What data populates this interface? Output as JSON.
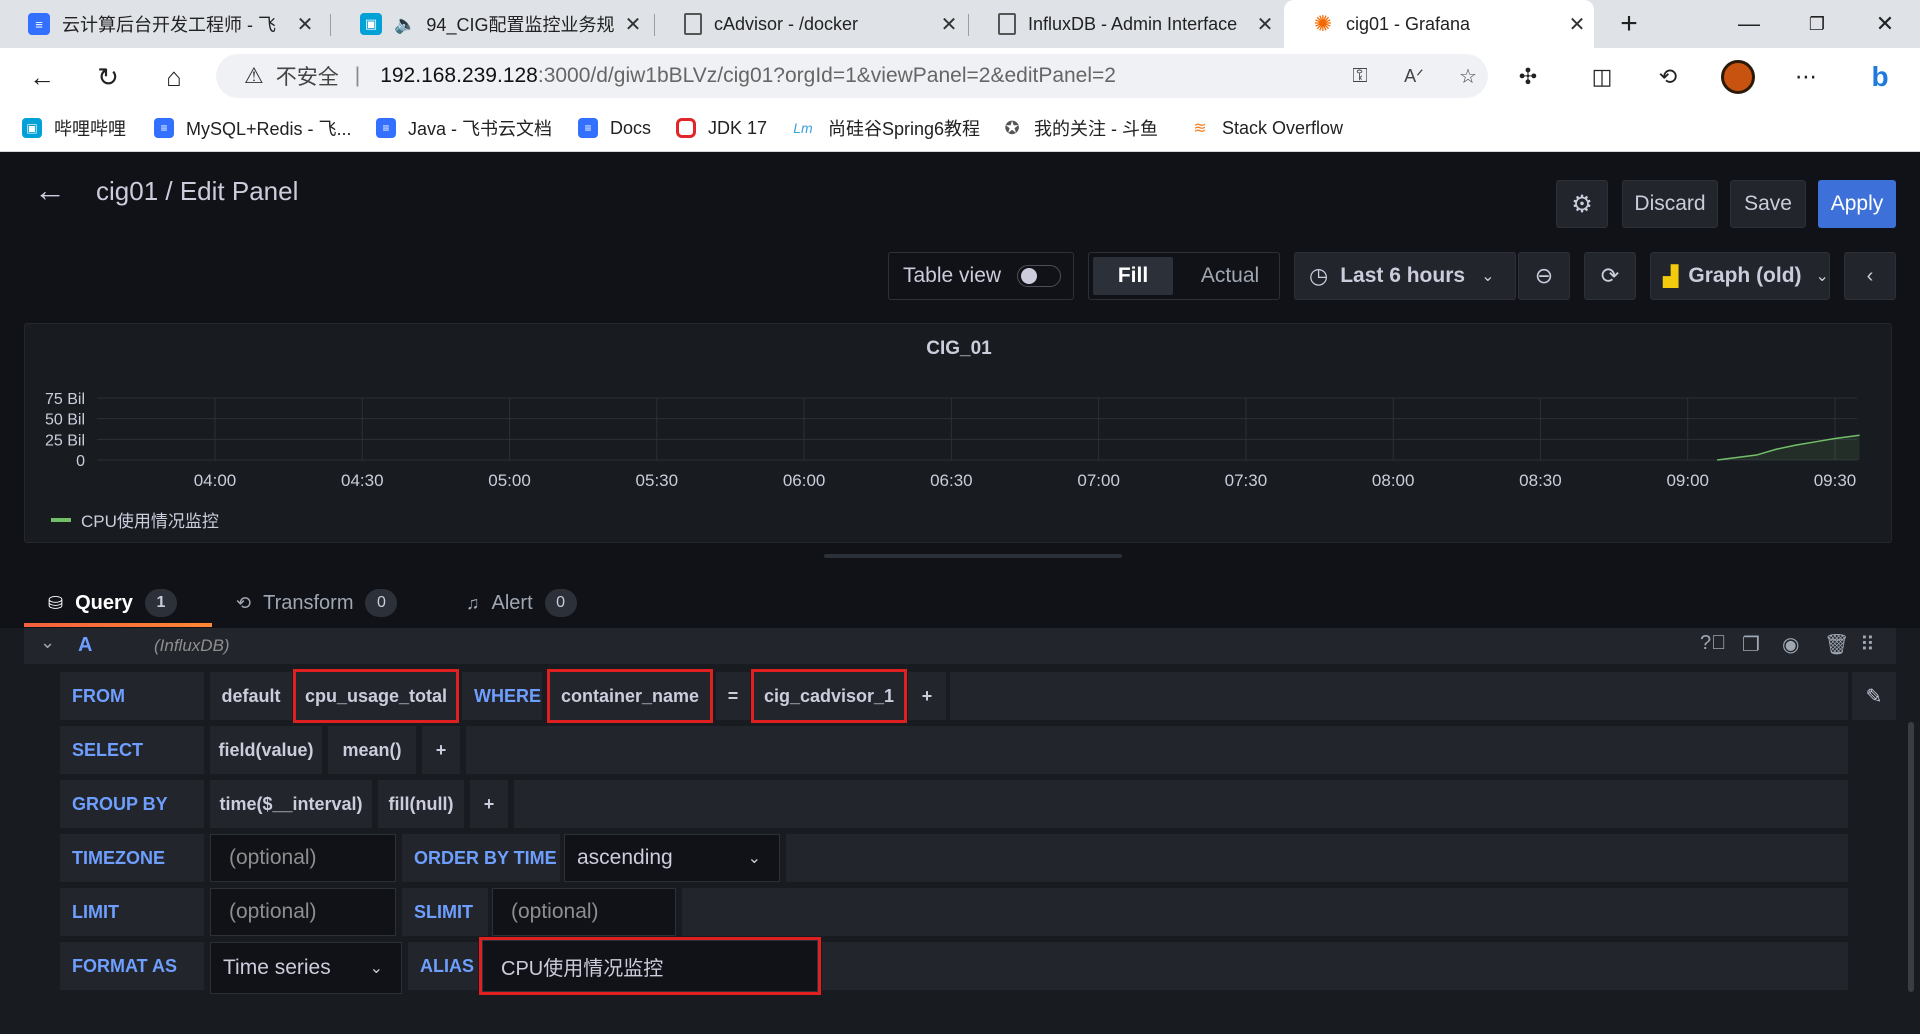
{
  "browser": {
    "tabs": [
      {
        "title": "云计算后台开发工程师 - 飞",
        "icon": "feishu-doc-icon",
        "color": "#3370ff"
      },
      {
        "title": "94_CIG配置监控业务规",
        "icon": "bilibili-icon",
        "color": "#00a1d6"
      },
      {
        "title": "cAdvisor - /docker",
        "icon": "page-icon",
        "color": "#555555"
      },
      {
        "title": "InfluxDB - Admin Interface",
        "icon": "page-icon",
        "color": "#555555"
      },
      {
        "title": "cig01 - Grafana",
        "icon": "grafana-icon",
        "color": "#f46800"
      }
    ],
    "new_tab": "+",
    "address": {
      "insecure_label": "不安全",
      "host": "192.168.239.128",
      "path": ":3000/d/giw1bBLVz/cig01?orgId=1&viewPanel=2&editPanel=2"
    },
    "bookmarks": [
      {
        "label": "哔哩哔哩",
        "icon": "bilibili-icon",
        "color": "#00a1d6"
      },
      {
        "label": "MySQL+Redis - 飞...",
        "icon": "feishu-doc-icon",
        "color": "#3370ff"
      },
      {
        "label": "Java - 飞书云文档",
        "icon": "feishu-doc-icon",
        "color": "#3370ff"
      },
      {
        "label": "Docs",
        "icon": "feishu-doc-icon",
        "color": "#3370ff"
      },
      {
        "label": "JDK 17",
        "icon": "oracle-icon",
        "color": "#e0262a"
      },
      {
        "label": "尚硅谷Spring6教程",
        "icon": "atguigu-icon",
        "color": "#3aa0e0"
      },
      {
        "label": "我的关注 - 斗鱼",
        "icon": "douyu-icon",
        "color": "#ff7700"
      },
      {
        "label": "Stack Overflow",
        "icon": "stackoverflow-icon",
        "color": "#f48024"
      }
    ]
  },
  "header": {
    "title": "cig01 / Edit Panel",
    "discard": "Discard",
    "save": "Save",
    "apply": "Apply",
    "accent": "#3d71d9"
  },
  "toolbar": {
    "table_view": "Table view",
    "fill": "Fill",
    "actual": "Actual",
    "time_range": "Last 6 hours",
    "visualization": "Graph (old)"
  },
  "chart_data": {
    "type": "line",
    "title": "CIG_01",
    "x_ticks": [
      "04:00",
      "04:30",
      "05:00",
      "05:30",
      "06:00",
      "06:30",
      "07:00",
      "07:30",
      "08:00",
      "08:30",
      "09:00",
      "09:30"
    ],
    "y_ticks": [
      "75 Bil",
      "50 Bil",
      "25 Bil",
      "0"
    ],
    "ylim": [
      0,
      75
    ],
    "grid": true,
    "legend_position": "bottom-left",
    "series": [
      {
        "name": "CPU使用情况监控",
        "color": "#73bf69",
        "x": [
          "09:06",
          "09:10",
          "09:14",
          "09:18",
          "09:22",
          "09:26",
          "09:30",
          "09:35"
        ],
        "values": [
          0,
          3,
          6,
          13,
          18,
          22,
          26,
          30
        ]
      }
    ]
  },
  "query_tabs": [
    {
      "label": "Query",
      "count": "1"
    },
    {
      "label": "Transform",
      "count": "0"
    },
    {
      "label": "Alert",
      "count": "0"
    }
  ],
  "query": {
    "ref": "A",
    "datasource": "(InfluxDB)",
    "from": {
      "label": "FROM",
      "policy": "default",
      "measurement": "cpu_usage_total",
      "where_label": "WHERE",
      "where_key": "container_name",
      "op": "=",
      "where_value": "cig_cadvisor_1",
      "plus": "+"
    },
    "select": {
      "label": "SELECT",
      "field": "field(value)",
      "fn": "mean()",
      "plus": "+"
    },
    "group_by": {
      "label": "GROUP BY",
      "time": "time($__interval)",
      "fill": "fill(null)",
      "plus": "+"
    },
    "timezone": {
      "label": "TIMEZONE",
      "placeholder": "(optional)",
      "order_label": "ORDER BY TIME",
      "order_value": "ascending"
    },
    "limit": {
      "label": "LIMIT",
      "placeholder": "(optional)",
      "slimit_label": "SLIMIT",
      "slimit_placeholder": "(optional)"
    },
    "format": {
      "label": "FORMAT AS",
      "value": "Time series",
      "alias_label": "ALIAS",
      "alias_value": "CPU使用情况监控"
    }
  }
}
